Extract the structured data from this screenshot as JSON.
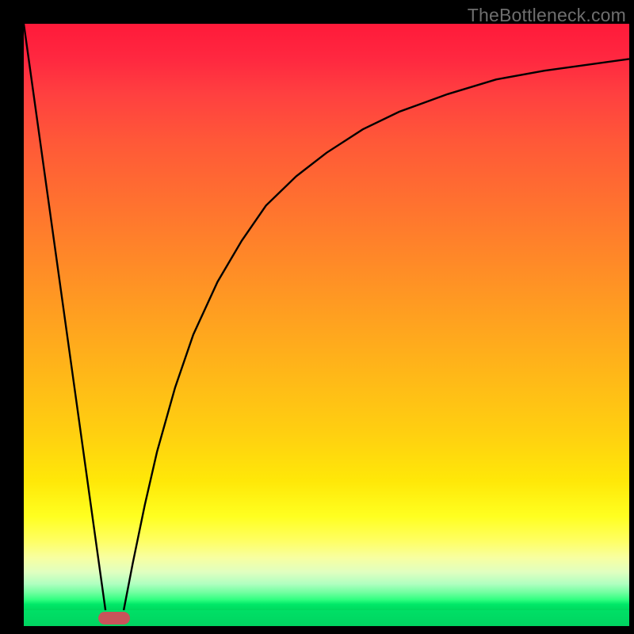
{
  "watermark": "TheBottleneck.com",
  "chart_data": {
    "type": "line",
    "title": "",
    "xlabel": "",
    "ylabel": "",
    "xlim": [
      0,
      100
    ],
    "ylim": [
      0,
      100
    ],
    "grid": false,
    "series": [
      {
        "name": "left-line",
        "x": [
          0,
          13.5
        ],
        "values": [
          100,
          0
        ]
      },
      {
        "name": "right-curve",
        "x": [
          16.5,
          18,
          20,
          22,
          25,
          28,
          32,
          36,
          40,
          45,
          50,
          56,
          62,
          70,
          78,
          86,
          93,
          100
        ],
        "values": [
          0,
          8,
          18,
          27,
          38,
          47,
          56,
          63,
          69,
          74,
          78,
          82,
          85,
          88,
          90.5,
          92,
          93,
          94
        ]
      }
    ],
    "marker": {
      "x_start": 12.3,
      "x_end": 17.5,
      "color": "#c9545a"
    },
    "background_gradient": {
      "stops": [
        {
          "pos": 0,
          "color": "#ff1a3a"
        },
        {
          "pos": 50,
          "color": "#ffa020"
        },
        {
          "pos": 84,
          "color": "#ffff20"
        },
        {
          "pos": 100,
          "color": "#00d85e"
        }
      ]
    }
  }
}
